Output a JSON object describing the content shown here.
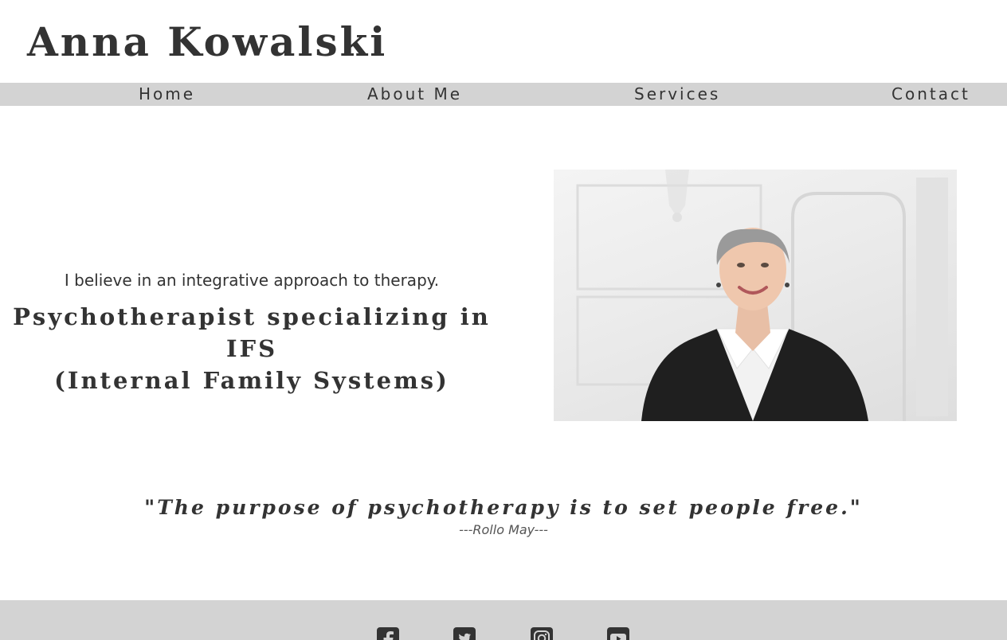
{
  "header": {
    "site_title": "Anna Kowalski"
  },
  "nav": {
    "items": [
      {
        "label": "Home"
      },
      {
        "label": "About Me"
      },
      {
        "label": "Services"
      },
      {
        "label": "Contact"
      }
    ]
  },
  "hero": {
    "tagline": "I believe in an integrative approach to therapy.",
    "headline_line1": "Psychotherapist specializing in IFS",
    "headline_line2": "(Internal Family Systems)"
  },
  "quote": {
    "text": "\"The purpose of psychotherapy is to set people free.\"",
    "author": "---Rollo May---"
  },
  "footer": {
    "social_icons": [
      "facebook-icon",
      "twitter-icon",
      "instagram-icon",
      "youtube-icon"
    ]
  },
  "colors": {
    "text": "#333333",
    "nav_bg": "#d3d3d3",
    "footer_bg": "#d3d3d3",
    "page_bg": "#ffffff"
  }
}
